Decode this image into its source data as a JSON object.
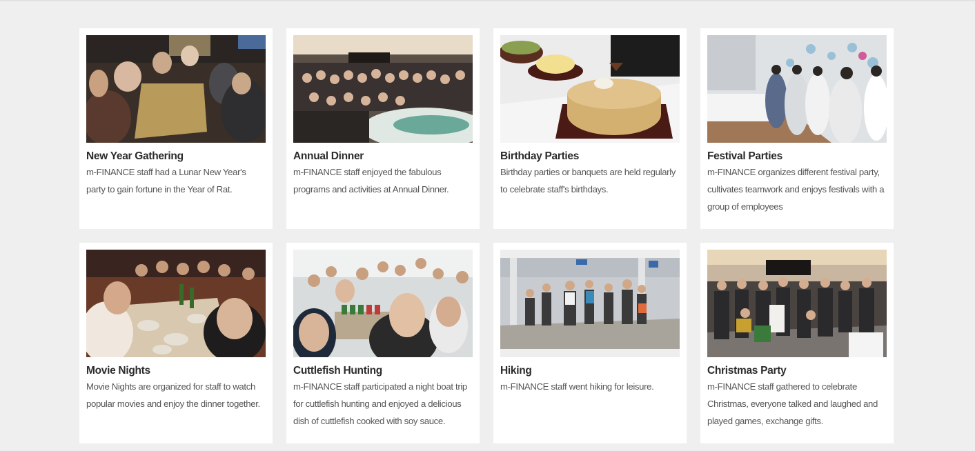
{
  "gallery": {
    "cards": [
      {
        "title": "New Year Gathering",
        "description": "m-FINANCE staff had a Lunar New Year's party to gain fortune in the Year of Rat."
      },
      {
        "title": "Annual Dinner",
        "description": "m-FINANCE staff enjoyed the fabulous programs and activities at Annual Dinner."
      },
      {
        "title": "Birthday Parties",
        "description": "Birthday parties or banquets are held regularly to celebrate staff's birthdays."
      },
      {
        "title": "Festival Parties",
        "description": "m-FINANCE organizes different festival party, cultivates teamwork and enjoys festivals with a group of employees"
      },
      {
        "title": "Movie Nights",
        "description": "Movie Nights are organized for staff to watch popular movies and enjoy the dinner together."
      },
      {
        "title": "Cuttlefish Hunting",
        "description": "m-FINANCE staff participated a night boat trip for cuttlefish hunting and enjoyed a delicious dish of cuttlefish cooked with soy sauce."
      },
      {
        "title": "Hiking",
        "description": "m-FINANCE staff went hiking for leisure."
      },
      {
        "title": "Christmas Party",
        "description": "m-FINANCE staff gathered to celebrate Christmas, everyone talked and laughed and played games, exchange gifts."
      }
    ]
  },
  "colors": {
    "page_background": "#efefef",
    "card_background": "#ffffff",
    "title_text": "#2b2b2b",
    "body_text": "#555555"
  }
}
